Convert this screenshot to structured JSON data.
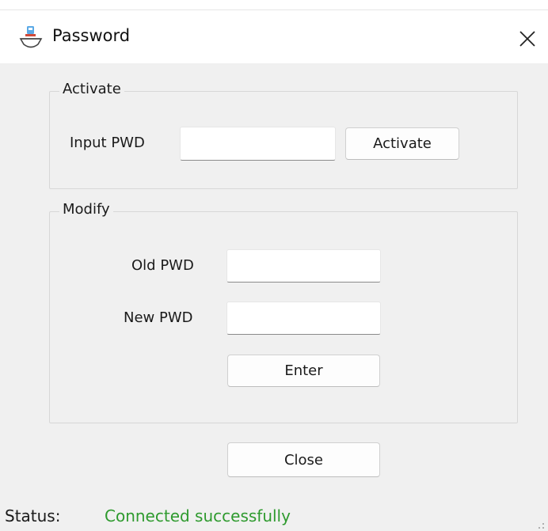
{
  "window": {
    "title": "Password",
    "title_icon": "app-icon",
    "close_icon": "close-icon"
  },
  "activate_group": {
    "legend": "Activate",
    "input_label": "Input PWD",
    "input_value": "",
    "button_label": "Activate"
  },
  "modify_group": {
    "legend": "Modify",
    "old_label": "Old PWD",
    "old_value": "",
    "new_label": "New PWD",
    "new_value": "",
    "enter_label": "Enter"
  },
  "close_button": {
    "label": "Close"
  },
  "status": {
    "label": "Status:",
    "value": "Connected successfully",
    "value_color": "#2e9a2e"
  },
  "colors": {
    "window_bg": "#f0f0f0",
    "titlebar_bg": "#ffffff"
  }
}
